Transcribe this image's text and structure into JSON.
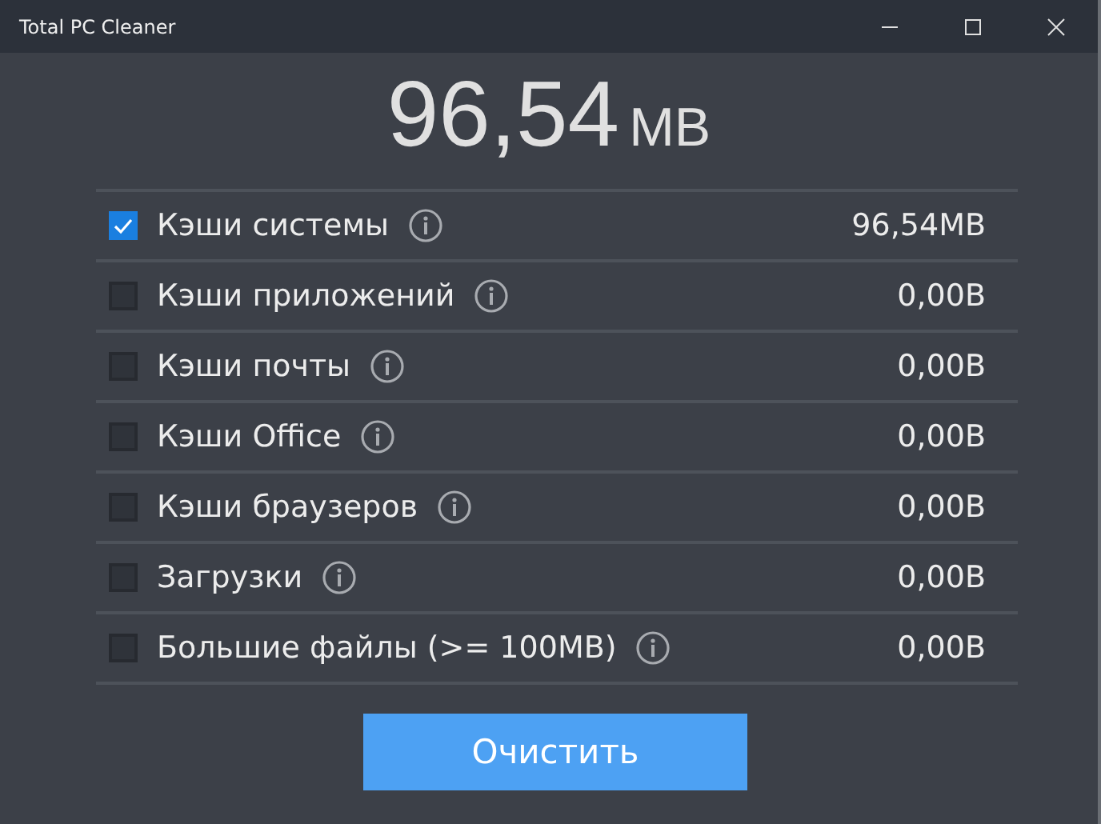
{
  "window": {
    "title": "Total PC Cleaner"
  },
  "total": {
    "value": "96,54",
    "unit": "MB"
  },
  "items": [
    {
      "label": "Кэши системы",
      "size": "96,54MB",
      "checked": true
    },
    {
      "label": "Кэши приложений",
      "size": "0,00B",
      "checked": false
    },
    {
      "label": "Кэши почты",
      "size": "0,00B",
      "checked": false
    },
    {
      "label": "Кэши Office",
      "size": "0,00B",
      "checked": false
    },
    {
      "label": "Кэши браузеров",
      "size": "0,00B",
      "checked": false
    },
    {
      "label": "Загрузки",
      "size": "0,00B",
      "checked": false
    },
    {
      "label": "Большие файлы (>= 100MB)",
      "size": "0,00B",
      "checked": false
    }
  ],
  "button": "Очистить"
}
